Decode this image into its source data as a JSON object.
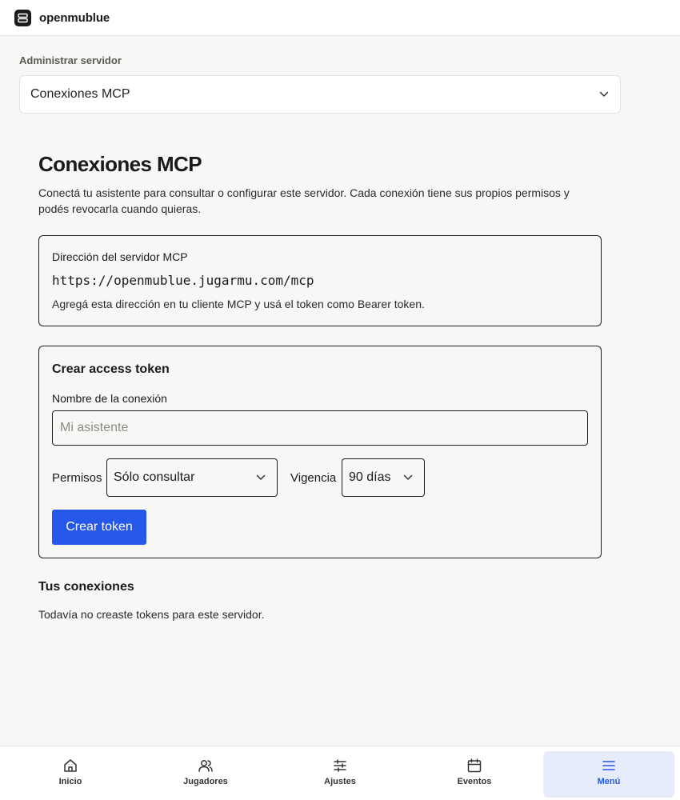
{
  "app": {
    "brand": "openmublue"
  },
  "admin": {
    "label": "Administrar servidor",
    "selected": "Conexiones MCP"
  },
  "page": {
    "title": "Conexiones MCP",
    "description": "Conectá tu asistente para consultar o configurar este servidor. Cada conexión tiene sus propios permisos y podés revocarla cuando quieras."
  },
  "server_card": {
    "label": "Dirección del servidor MCP",
    "url": "https://openmublue.jugarmu.com/mcp",
    "help": "Agregá esta dirección en tu cliente MCP y usá el token como Bearer token."
  },
  "token_card": {
    "title": "Crear access token",
    "name_label": "Nombre de la conexión",
    "name_value": "",
    "name_placeholder": "Mi asistente",
    "permissions_label": "Permisos",
    "permissions_value": "Sólo consultar",
    "validity_label": "Vigencia",
    "validity_value": "90 días",
    "create_button": "Crear token"
  },
  "connections": {
    "title": "Tus conexiones",
    "empty": "Todavía no creaste tokens para este servidor."
  },
  "bottom_nav": {
    "items": [
      {
        "label": "Inicio",
        "icon": "home-icon"
      },
      {
        "label": "Jugadores",
        "icon": "users-icon"
      },
      {
        "label": "Ajustes",
        "icon": "sliders-icon"
      },
      {
        "label": "Eventos",
        "icon": "calendar-icon"
      },
      {
        "label": "Menú",
        "icon": "menu-icon",
        "active": true
      }
    ]
  },
  "colors": {
    "accent": "#2557e8",
    "active_nav_bg": "#e6ecfa",
    "page_bg": "#f7f7f5"
  }
}
